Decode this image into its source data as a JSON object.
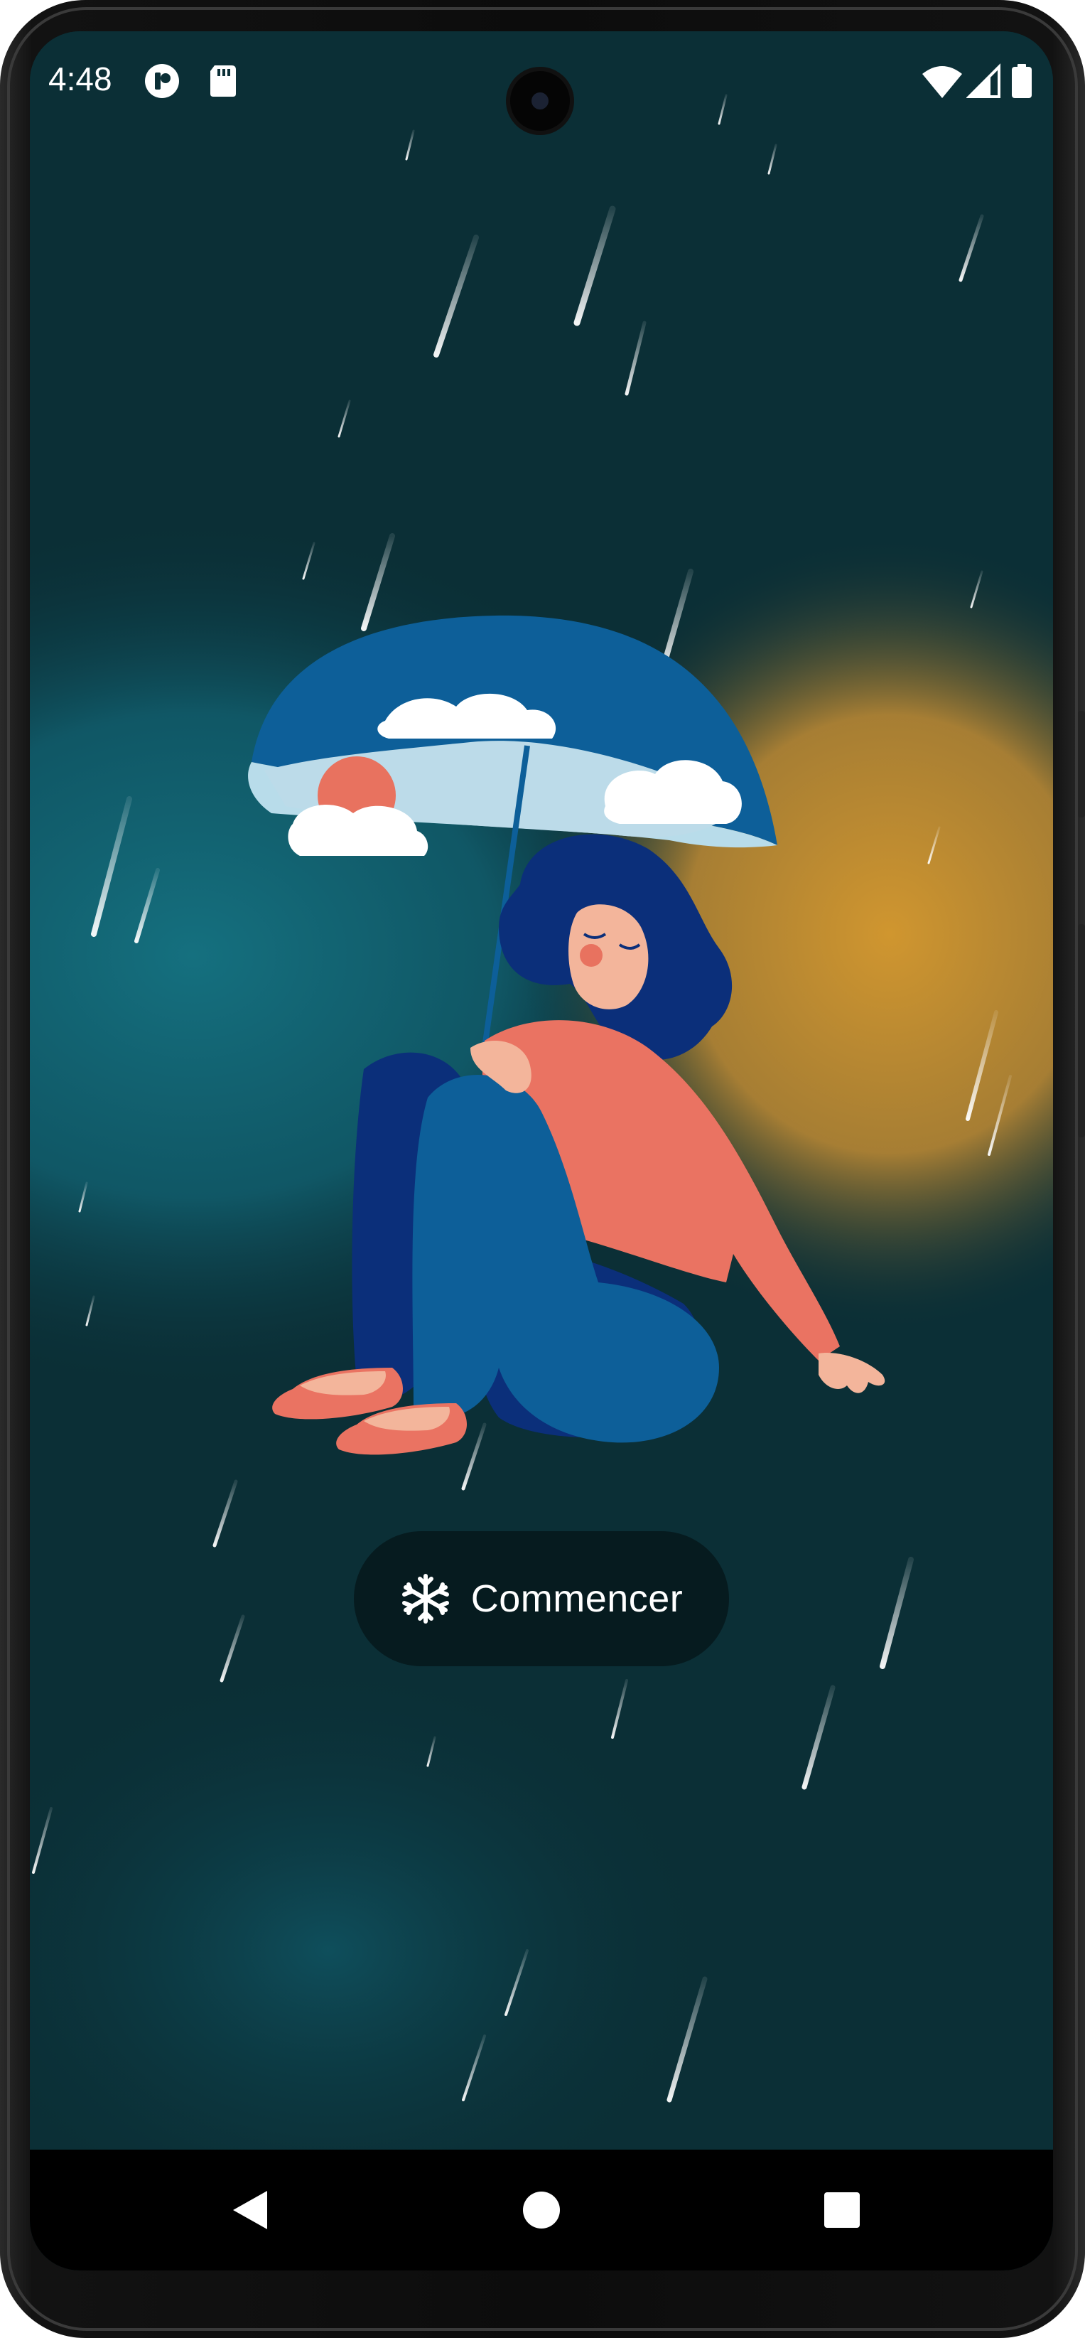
{
  "status_bar": {
    "time": "4:48",
    "left_icons": [
      "app-notification-icon",
      "sd-card-icon"
    ],
    "right_icons": [
      "wifi-icon",
      "cellular-signal-icon",
      "battery-icon"
    ]
  },
  "main": {
    "start_button": {
      "label": "Commencer",
      "icon": "snowflake-icon"
    }
  },
  "navigation_bar": {
    "buttons": [
      "back",
      "home",
      "recents"
    ]
  },
  "colors": {
    "background": "#0b2f36",
    "glow_teal": "#126573",
    "glow_orange": "#c8922f",
    "button_background": "#061b1f",
    "text": "#ffffff"
  }
}
